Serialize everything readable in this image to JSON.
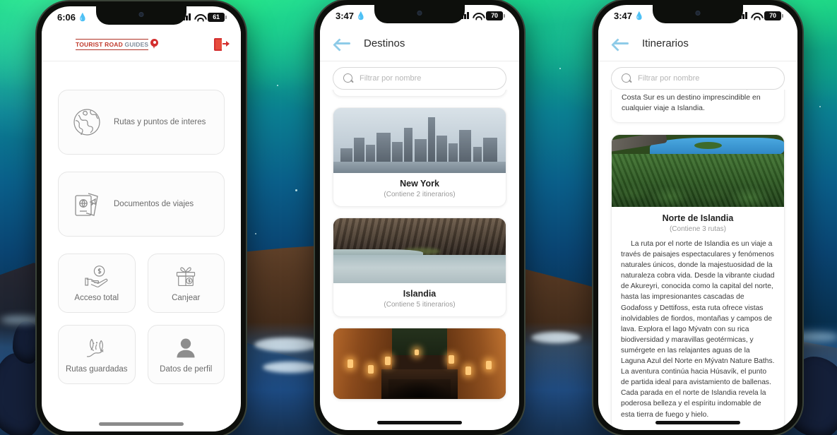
{
  "background": {
    "name": "aurora-borealis-iceland-coast",
    "sky_green": "#11d06f",
    "sky_blue": "#0a4472",
    "rock_brown": "#533722"
  },
  "phone1": {
    "statusbar": {
      "time": "6:06",
      "battery": "61",
      "drop_icon": "water-drop-icon",
      "signal_icon": "cellular-signal-icon",
      "wifi_icon": "wifi-icon"
    },
    "header": {
      "logo_main": "TOURIST ROAD",
      "logo_sub": "GUIDES",
      "logo_pin_icon": "map-pin-icon",
      "logout_icon": "logout-icon"
    },
    "menu": [
      {
        "label": "Rutas y puntos de interes",
        "icon": "globe-icon",
        "style": "wide"
      },
      {
        "label": "Documentos de viajes",
        "icon": "passport-icon",
        "style": "wide"
      },
      {
        "label": "Acceso total",
        "icon": "hand-money-icon",
        "style": "tile"
      },
      {
        "label": "Canjear",
        "icon": "gift-icon",
        "style": "tile"
      },
      {
        "label": "Rutas guardadas",
        "icon": "saved-route-icon",
        "style": "tile"
      },
      {
        "label": "Datos de perfil",
        "icon": "user-profile-icon",
        "style": "tile"
      }
    ]
  },
  "phone2": {
    "statusbar": {
      "time": "3:47",
      "battery": "70",
      "drop_icon": "water-drop-icon",
      "signal_icon": "cellular-signal-icon",
      "wifi_icon": "wifi-icon"
    },
    "header": {
      "title": "Destinos",
      "back_icon": "back-arrow-icon"
    },
    "search": {
      "placeholder": "Filtrar por nombre",
      "value": "",
      "icon": "search-icon"
    },
    "destinations": [
      {
        "title": "New York",
        "subtitle": "(Contiene 2 itinerarios)",
        "image": "new-york-skyline"
      },
      {
        "title": "Islandia",
        "subtitle": "(Contiene 5 itinerarios)",
        "image": "iceland-waterfall"
      },
      {
        "title": "",
        "subtitle": "",
        "image": "japan-street-lanterns"
      }
    ]
  },
  "phone3": {
    "statusbar": {
      "time": "3:47",
      "battery": "70",
      "drop_icon": "water-drop-icon",
      "signal_icon": "cellular-signal-icon",
      "wifi_icon": "wifi-icon"
    },
    "header": {
      "title": "Itinerarios",
      "back_icon": "back-arrow-icon"
    },
    "search": {
      "placeholder": "Filtrar por nombre",
      "value": "",
      "icon": "search-icon"
    },
    "partial_card": {
      "text": "acceso a fenómenos naturales únicos, la Costa Sur es un destino imprescindible en cualquier viaje a Islandia."
    },
    "itinerary": {
      "title": "Norte de Islandia",
      "subtitle": "(Contiene 3 rutas)",
      "image": "iceland-north-forest-lake",
      "description": "La ruta por el norte de Islandia es un viaje a través de paisajes espectaculares y fenómenos naturales únicos, donde la majestuosidad de la naturaleza cobra vida. Desde la vibrante ciudad de Akureyri, conocida como la capital del norte, hasta las impresionantes cascadas de Godafoss y Dettifoss, esta ruta ofrece vistas inolvidables de fiordos, montañas y campos de lava. Explora el lago Mývatn con su rica biodiversidad y maravillas geotérmicas, y sumérgete en las relajantes aguas de la Laguna Azul del Norte en Mývatn Nature Baths. La aventura continúa hacia Húsavík, el punto de partida ideal para avistamiento de ballenas. Cada parada en el norte de Islandia revela la poderosa belleza y el espíritu indomable de esta tierra de fuego y hielo."
    }
  }
}
